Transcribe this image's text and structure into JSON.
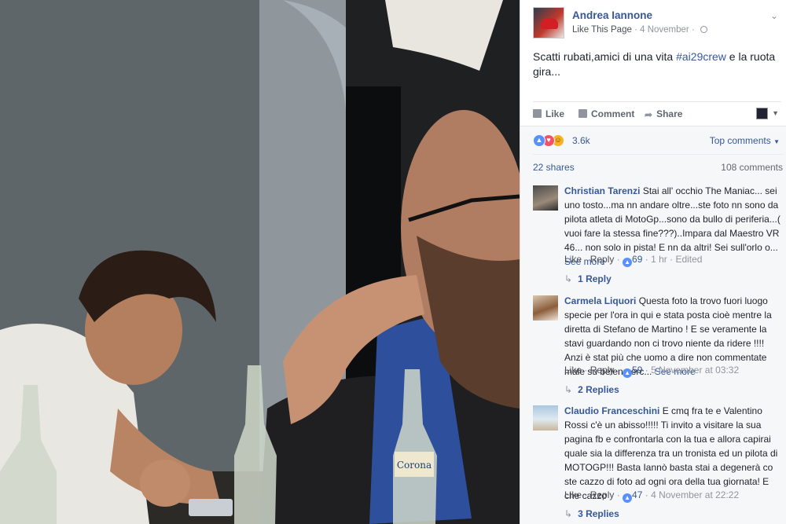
{
  "post": {
    "page_name": "Andrea Iannone",
    "like_page": "Like This Page",
    "date": "4 November",
    "caption_before": "Scatti rubati,amici di una vita ",
    "hashtag": "#ai29crew",
    "caption_after": " e la ruota gira..."
  },
  "actions": {
    "like": "Like",
    "comment": "Comment",
    "share": "Share"
  },
  "feedback": {
    "reaction_count": "3.6k",
    "top_comments": "Top comments",
    "shares": "22 shares",
    "comments_count": "108 comments"
  },
  "comments": [
    {
      "author": "Christian Tarenzi",
      "text": "Stai all' occhio The Maniac... sei uno tosto...ma nn andare oltre...ste foto nn sono da pilota atleta di MotoGp...sono da bullo di periferia...( vuoi fare la stessa fine???)..Impara dal Maestro VR 46... non solo in pista! E nn da altri! Sei sull'orlo o...",
      "see_more": "See more",
      "like": "Like",
      "reply": "Reply",
      "likes": "69",
      "time": "1 hr",
      "edited": "Edited",
      "replies": "1 Reply"
    },
    {
      "author": "Carmela Liquori",
      "text": "Questa foto la trovo fuori luogo specie per l'ora in qui e stata posta cioè mentre la diretta di Stefano de Martino ! E se veramente la stavi guardando non ci trovo niente da ridere !!!! Anzi è stat più che uomo a dire non commentate male su belen perc...",
      "see_more": "See more",
      "like": "Like",
      "reply": "Reply",
      "likes": "59",
      "time": "5 November at 03:32",
      "replies": "2 Replies"
    },
    {
      "author": "Claudio Franceschini",
      "text": "E cmq fra te e Valentino Rossi c'è un abisso!!!!! Ti invito a visitare la sua pagina fb e confrontarla con la tua e allora capirai quale sia la differenza tra un tronista ed un pilota di MOTOGP!!! Basta Iannò basta stai a degenerà co ste cazzo di foto ad ogni ora della tua giornata! E che cazzo",
      "like": "Like",
      "reply": "Reply",
      "likes": "47",
      "time": "4 November at 22:22",
      "replies": "3 Replies"
    }
  ],
  "photo": {
    "bottle_label": "Corona"
  },
  "colors": {
    "link": "#365899",
    "meta": "#90949c",
    "panel_bg": "#f6f7f9"
  },
  "icons": [
    "globe-icon",
    "like-icon",
    "comment-icon",
    "share-icon",
    "love-reaction-icon",
    "haha-reaction-icon",
    "reply-arrow-icon",
    "chevron-down-icon"
  ]
}
